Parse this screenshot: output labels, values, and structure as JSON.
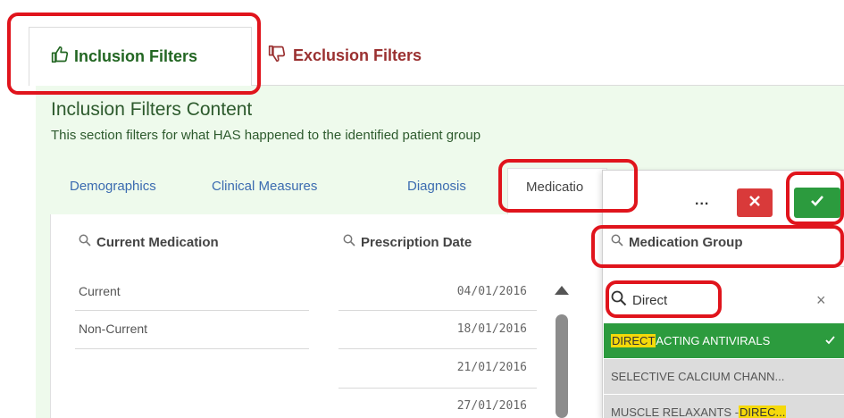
{
  "top_tabs": {
    "inclusion_label": "Inclusion Filters",
    "exclusion_label": "Exclusion Filters"
  },
  "panel": {
    "title": "Inclusion Filters Content",
    "subtitle": "This section filters for what HAS happened to the identified patient group"
  },
  "sub_tabs": [
    "Demographics",
    "Clinical Measures",
    "Diagnosis",
    "Medicatio"
  ],
  "filters": {
    "current_medication": {
      "header": "Current Medication",
      "values": [
        "Current",
        "Non-Current"
      ]
    },
    "prescription_date": {
      "header": "Prescription Date",
      "values": [
        "04/01/2016",
        "18/01/2016",
        "21/01/2016",
        "27/01/2016"
      ]
    }
  },
  "popup": {
    "more_label": "...",
    "header": "Medication Group",
    "search_value": "Direct",
    "items": [
      {
        "highlight": "DIRECT",
        "rest": " ACTING ANTIVIRALS",
        "state": "selected"
      },
      {
        "highlight": "",
        "rest": "SELECTIVE CALCIUM CHANN...",
        "state": "alt"
      },
      {
        "prefix": "MUSCLE RELAXANTS - ",
        "highlight": "DIREC...",
        "state": "alt"
      }
    ]
  },
  "colors": {
    "accent_green": "#2c9b3e",
    "cancel_red": "#d93a3a",
    "annotation_red": "#e0141c",
    "panel_bg": "#eefaec",
    "search_highlight": "#f5d90a"
  },
  "icons": {
    "inclusion": "thumbs-up-icon",
    "exclusion": "thumbs-down-icon",
    "search": "search-icon",
    "cancel": "close-icon",
    "confirm": "check-icon"
  }
}
